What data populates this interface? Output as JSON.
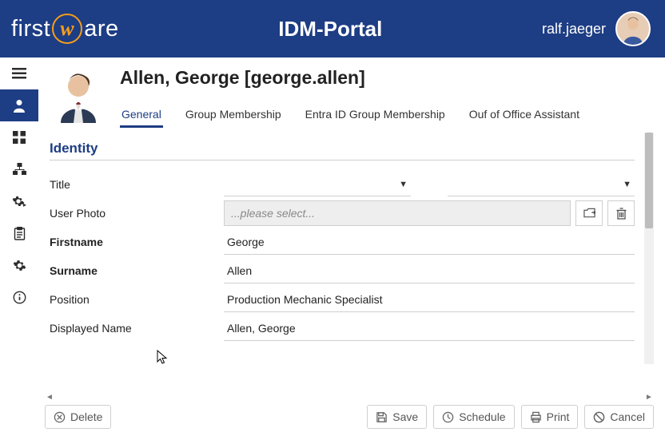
{
  "logo": {
    "left": "first",
    "right": "are",
    "w": "w"
  },
  "app_title": "IDM-Portal",
  "user": {
    "name": "ralf.jaeger"
  },
  "profile": {
    "heading": "Allen, George [george.allen]"
  },
  "tabs": [
    {
      "label": "General",
      "active": true
    },
    {
      "label": "Group Membership",
      "active": false
    },
    {
      "label": "Entra ID Group Membership",
      "active": false
    },
    {
      "label": "Ouf of Office Assistant",
      "active": false
    }
  ],
  "section": {
    "title": "Identity"
  },
  "fields": {
    "title_label": "Title",
    "user_photo_label": "User Photo",
    "photo_placeholder": "...please select...",
    "firstname_label": "Firstname",
    "firstname_value": "George",
    "surname_label": "Surname",
    "surname_value": "Allen",
    "position_label": "Position",
    "position_value": "Production Mechanic Specialist",
    "displayed_name_label": "Displayed Name",
    "displayed_name_value": "Allen, George"
  },
  "footer": {
    "delete": "Delete",
    "save": "Save",
    "schedule": "Schedule",
    "print": "Print",
    "cancel": "Cancel"
  }
}
